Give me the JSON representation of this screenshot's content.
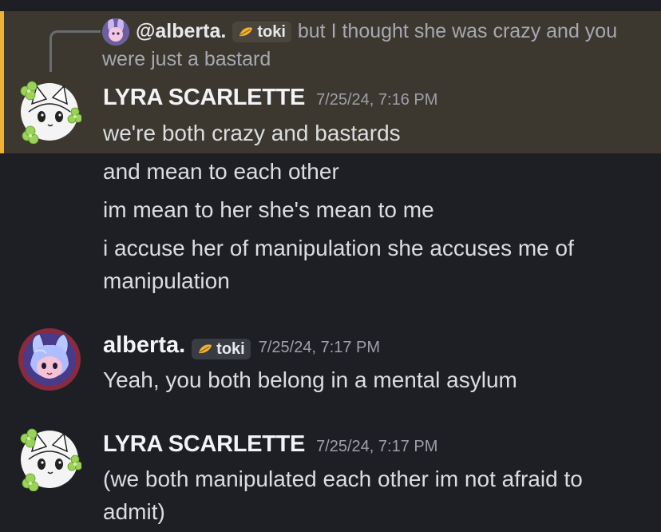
{
  "reply": {
    "username": "@alberta.",
    "tag": "toki",
    "text": "but I thought she was crazy and you were just a bastard"
  },
  "messages": [
    {
      "author": "LYRA SCARLETTE",
      "timestamp": "7/25/24, 7:16 PM",
      "lines": [
        "we're both crazy and bastards",
        "and mean to each other",
        "im mean to her she's mean to me",
        "i accuse her of manipulation she accuses me of manipulation"
      ]
    },
    {
      "author": "alberta.",
      "tag": "toki",
      "timestamp": "7/25/24, 7:17 PM",
      "lines": [
        "Yeah, you both belong in a mental asylum"
      ]
    },
    {
      "author": "LYRA SCARLETTE",
      "timestamp": "7/25/24, 7:17 PM",
      "lines": [
        "(we both manipulated each other im not afraid to admit)"
      ]
    }
  ],
  "colors": {
    "background": "#1e1f25",
    "mention_highlight": "#3d382f",
    "mention_bar": "#f0b232",
    "tag_icon": "#f0b232"
  },
  "icons": {
    "tag": "leaf-badge-icon",
    "avatar_lyra": "white-cat-clover-avatar",
    "avatar_alberta": "pink-bunny-avatar"
  }
}
